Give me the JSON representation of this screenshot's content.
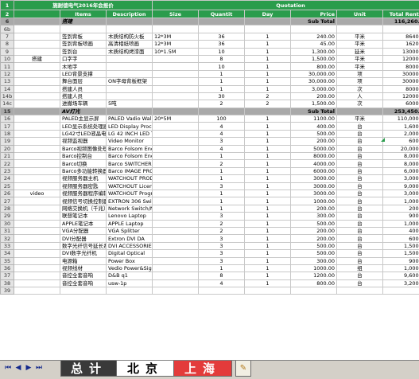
{
  "sheet_title": "施耐德电气2016年会报价",
  "quotation_label": "Quotation",
  "headers": {
    "items": "Items",
    "description": "Description",
    "size": "Size",
    "quantity": "Quantit",
    "day": "Day",
    "price": "Price",
    "unit": "Unit",
    "total": "Total Renta"
  },
  "section1": {
    "row": "6",
    "name": "搭建",
    "subtotal_label": "Sub Total",
    "subtotal": "116,260.00"
  },
  "section2": {
    "row": "15",
    "name": "AV灯光",
    "subtotal_label": "Sub Total",
    "subtotal": "253,450.00"
  },
  "build_rows": [
    {
      "row": "6b",
      "cat": "",
      "item": "",
      "desc": "",
      "size": "",
      "qty": "",
      "day": "",
      "price": "",
      "unit": "",
      "total": ""
    },
    {
      "row": "7",
      "cat": "",
      "item": "签到背板",
      "desc": "木质结构防火板",
      "size": "12*3M",
      "qty": "36",
      "day": "1",
      "price": "240.00",
      "unit": "平米",
      "total": "8640.00"
    },
    {
      "row": "8",
      "cat": "",
      "item": "签到背板喷画",
      "desc": "高清相纸喷画",
      "size": "12*3M",
      "qty": "36",
      "day": "1",
      "price": "45.00",
      "unit": "平米",
      "total": "1620.00"
    },
    {
      "row": "9",
      "cat": "",
      "item": "签到台",
      "desc": "木质结构烤漆面",
      "size": "10*1.5M",
      "qty": "10",
      "day": "1",
      "price": "1,300.00",
      "unit": "延米",
      "total": "13000.00"
    },
    {
      "row": "10",
      "cat": "搭建",
      "item": "口字字",
      "desc": "",
      "size": "",
      "qty": "8",
      "day": "1",
      "price": "1,500.00",
      "unit": "平米",
      "total": "12000.00"
    },
    {
      "row": "11",
      "cat": "",
      "item": "木地字",
      "desc": "",
      "size": "",
      "qty": "10",
      "day": "1",
      "price": "800.00",
      "unit": "平米",
      "total": "8000.00"
    },
    {
      "row": "12",
      "cat": "",
      "item": "LED背景支撑",
      "desc": "",
      "size": "",
      "qty": "1",
      "day": "1",
      "price": "30,000.00",
      "unit": "项",
      "total": "30000.00"
    },
    {
      "row": "13",
      "cat": "",
      "item": "舞台面层",
      "desc": "ON字母背板框架",
      "size": "",
      "qty": "1",
      "day": "1",
      "price": "30,000.00",
      "unit": "项",
      "total": "30000.00"
    },
    {
      "row": "14",
      "cat": "",
      "item": "搭建人员",
      "desc": "",
      "size": "",
      "qty": "1",
      "day": "1",
      "price": "3,000.00",
      "unit": "次",
      "total": "8000.00"
    },
    {
      "row": "14b",
      "cat": "",
      "item": "搭建人员",
      "desc": "",
      "size": "",
      "qty": "30",
      "day": "2",
      "price": "200.00",
      "unit": "人",
      "total": "12000.00"
    },
    {
      "row": "14c",
      "cat": "",
      "item": "进撤场车辆",
      "desc": "5吨",
      "size": "",
      "qty": "2",
      "day": "2",
      "price": "1,500.00",
      "unit": "次",
      "total": "6000.00"
    }
  ],
  "av_rows": [
    {
      "row": "16",
      "cat": "",
      "item": "PALED主显示屏",
      "desc": "PALED Vadio Wall(500mm*500mm)",
      "size": "20*5M",
      "qty": "100",
      "day": "1",
      "price": "1100.00",
      "unit": "平米",
      "total": "110,000.00"
    },
    {
      "row": "17",
      "cat": "",
      "item": "LED显示系统处理器",
      "desc": "LED Display Processor",
      "size": "",
      "qty": "4",
      "day": "1",
      "price": "400.00",
      "unit": "台",
      "total": "1,600.00"
    },
    {
      "row": "18",
      "cat": "",
      "item": "LG42寸LED液晶电视",
      "desc": "LG 42 INCH LED TV 102*62cm/32  落地支架",
      "size": "",
      "qty": "4",
      "day": "1",
      "price": "500.00",
      "unit": "台",
      "total": "2,000.00"
    },
    {
      "row": "19",
      "cat": "",
      "item": "视频监视器",
      "desc": "Video Monitor",
      "size": "",
      "qty": "3",
      "day": "1",
      "price": "200.00",
      "unit": "台",
      "total": "600.00"
    },
    {
      "row": "20",
      "cat": "",
      "item": "Barco视频图像处理器",
      "desc": "Barco Folsom Encore HD VP",
      "size": "",
      "qty": "4",
      "day": "1",
      "price": "5000.00",
      "unit": "台",
      "total": "20,000.00"
    },
    {
      "row": "21",
      "cat": "",
      "item": "Barco控制台",
      "desc": "Barco Folsom Encore Controller",
      "size": "",
      "qty": "1",
      "day": "1",
      "price": "8000.00",
      "unit": "台",
      "total": "8,000.00"
    },
    {
      "row": "22",
      "cat": "",
      "item": "Barco切换",
      "desc": "Barco SWITCHER",
      "size": "",
      "qty": "2",
      "day": "1",
      "price": "4000.00",
      "unit": "台",
      "total": "8,000.00"
    },
    {
      "row": "23",
      "cat": "",
      "item": "Barco多功能转换器",
      "desc": "Barco IMAGE PRO",
      "size": "",
      "qty": "1",
      "day": "1",
      "price": "6000.00",
      "unit": "台",
      "total": "6,000.00"
    },
    {
      "row": "24",
      "cat": "",
      "item": "视频服务器主机",
      "desc": "WATCHOUT PRODUCTION DISPLAY V5.0",
      "size": "",
      "qty": "1",
      "day": "1",
      "price": "3000.00",
      "unit": "台",
      "total": "3,000.00"
    },
    {
      "row": "25",
      "cat": "",
      "item": "视频服务器密匙",
      "desc": "WATCHOUT License Key",
      "size": "",
      "qty": "3",
      "day": "1",
      "price": "3000.00",
      "unit": "台",
      "total": "9,000.00"
    },
    {
      "row": "26",
      "cat": "video",
      "item": "视频服务器程序编辑",
      "desc": "WATCHOUT Program",
      "size": "",
      "qty": "1",
      "day": "1",
      "price": "3000.00",
      "unit": "台",
      "total": "3,000.00"
    },
    {
      "row": "27",
      "cat": "",
      "item": "视频信号切换控制器",
      "desc": "EXTRON 306 Switcher",
      "size": "",
      "qty": "1",
      "day": "1",
      "price": "1000.00",
      "unit": "台",
      "total": "1,000.00"
    },
    {
      "row": "28",
      "cat": "",
      "item": "网络交换机（千兆）",
      "desc": "Network Switch/NETGEAR JGS524",
      "size": "",
      "qty": "1",
      "day": "1",
      "price": "200.00",
      "unit": "台",
      "total": "200.00"
    },
    {
      "row": "29",
      "cat": "",
      "item": "联想笔记本",
      "desc": "Lenovo Laptop",
      "size": "",
      "qty": "3",
      "day": "1",
      "price": "300.00",
      "unit": "台",
      "total": "900.00"
    },
    {
      "row": "30",
      "cat": "",
      "item": "APPLE笔记本",
      "desc": "APPLE Laptop",
      "size": "",
      "qty": "2",
      "day": "1",
      "price": "500.00",
      "unit": "台",
      "total": "1,000.00"
    },
    {
      "row": "31",
      "cat": "",
      "item": "VGA分配器",
      "desc": "VGA Splitter",
      "size": "",
      "qty": "2",
      "day": "1",
      "price": "200.00",
      "unit": "台",
      "total": "400.00"
    },
    {
      "row": "32",
      "cat": "",
      "item": "DVI分配器",
      "desc": "Extron DVI DA",
      "size": "",
      "qty": "3",
      "day": "1",
      "price": "200.00",
      "unit": "台",
      "total": "600.00"
    },
    {
      "row": "33",
      "cat": "",
      "item": "数字光纤信号延长系统",
      "desc": "DVI ACCESSORIES",
      "size": "",
      "qty": "3",
      "day": "1",
      "price": "500.00",
      "unit": "台",
      "total": "1,500.00"
    },
    {
      "row": "34",
      "cat": "",
      "item": "DVI数字光纤机",
      "desc": "Digital Optical",
      "size": "",
      "qty": "3",
      "day": "1",
      "price": "500.00",
      "unit": "台",
      "total": "1,500.00"
    },
    {
      "row": "35",
      "cat": "",
      "item": "电源箱",
      "desc": "Power Box",
      "size": "",
      "qty": "3",
      "day": "1",
      "price": "300.00",
      "unit": "台",
      "total": "900.00"
    },
    {
      "row": "36",
      "cat": "",
      "item": "视频线材",
      "desc": "Vedio Power&Signal Cable",
      "size": "",
      "qty": "1",
      "day": "1",
      "price": "1000.00",
      "unit": "组",
      "total": "1,000.00"
    },
    {
      "row": "37",
      "cat": "",
      "item": "音控全套音响",
      "desc": "D&B  q1",
      "size": "",
      "qty": "8",
      "day": "1",
      "price": "1200.00",
      "unit": "台",
      "total": "9,600.00"
    },
    {
      "row": "38",
      "cat": "",
      "item": "音控全套音响",
      "desc": "usw-1p",
      "size": "",
      "qty": "4",
      "day": "1",
      "price": "800.00",
      "unit": "台",
      "total": "3,200.00"
    },
    {
      "row": "39",
      "cat": "",
      "item": "",
      "desc": "",
      "size": "",
      "qty": "",
      "day": "",
      "price": "",
      "unit": "",
      "total": ""
    }
  ],
  "tabs": {
    "zongji": "总计",
    "beijing": "北京",
    "shanghai": "上海"
  },
  "colors": {
    "header_green": "#2a9c4c",
    "section_gray": "#a9a9a9",
    "tab_red": "#e33b3b",
    "tab_dark": "#3a3a3a"
  }
}
